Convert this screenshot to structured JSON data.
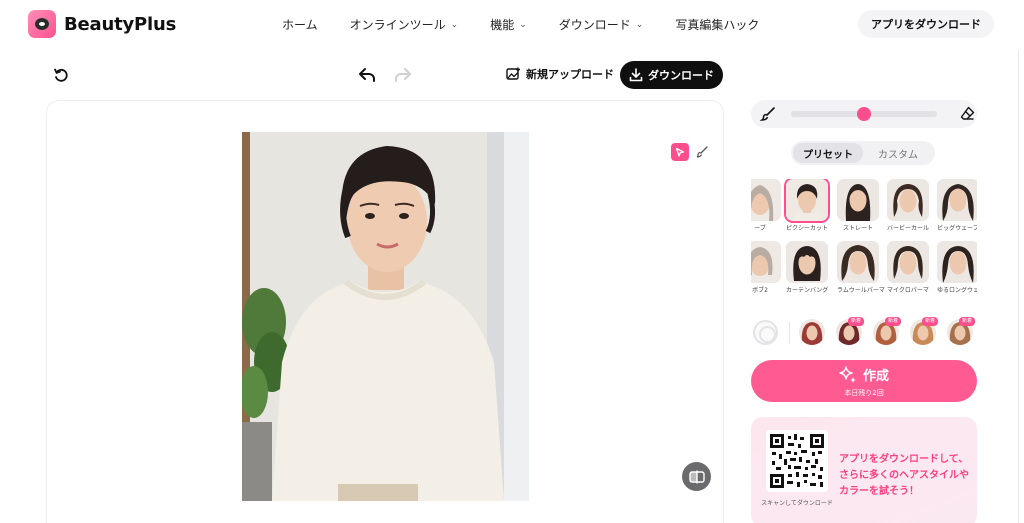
{
  "app": {
    "name": "BeautyPlus"
  },
  "nav": {
    "items": [
      {
        "label": "ホーム",
        "has_caret": false
      },
      {
        "label": "オンラインツール",
        "has_caret": true
      },
      {
        "label": "機能",
        "has_caret": true
      },
      {
        "label": "ダウンロード",
        "has_caret": true
      },
      {
        "label": "写真編集ハック",
        "has_caret": false
      }
    ],
    "app_download": "アプリをダウンロード"
  },
  "toolbar": {
    "reset_icon": "reset-icon",
    "undo_icon": "undo-icon",
    "redo_icon": "redo-icon",
    "new_upload": "新規アップロード",
    "download": "ダウンロード"
  },
  "canvas": {
    "mode_select_icon": "cursor-icon",
    "mode_brush_icon": "brush-icon",
    "compare_icon": "compare-icon"
  },
  "brush": {
    "size_level": 0.5
  },
  "tabs": {
    "preset": "プリセット",
    "custom": "カスタム"
  },
  "presets": [
    {
      "name": "ーブ",
      "selected": false
    },
    {
      "name": "ピクシーカット",
      "selected": true
    },
    {
      "name": "ストレート",
      "selected": false
    },
    {
      "name": "バービーカール",
      "selected": false
    },
    {
      "name": "ビッグウェーブ",
      "selected": false
    },
    {
      "name": "ボブ2",
      "selected": false
    },
    {
      "name": "カーテンバング",
      "selected": false
    },
    {
      "name": "ラムウールパーマ",
      "selected": false
    },
    {
      "name": "マイクロパーマ",
      "selected": false
    },
    {
      "name": "ゆるロングウェーブ",
      "selected": false
    }
  ],
  "colors": {
    "none_icon": "no-color-icon",
    "swatches": [
      {
        "badge": "",
        "color": "#9b3a36"
      },
      {
        "badge": "新着",
        "color": "#6e2a2a"
      },
      {
        "badge": "新着",
        "color": "#b0603f"
      },
      {
        "badge": "新着",
        "color": "#c98a58"
      },
      {
        "badge": "新着",
        "color": "#a5704a"
      }
    ]
  },
  "create": {
    "label": "作成",
    "remaining": "本日残り2回"
  },
  "promo": {
    "qr_caption": "スキャンしてダウンロード",
    "text": "アプリをダウンロードして、さらに多くのヘアスタイルやカラーを試そう！"
  },
  "colors_theme": {
    "accent": "#ff4d8d",
    "dark": "#0f0f0f"
  }
}
